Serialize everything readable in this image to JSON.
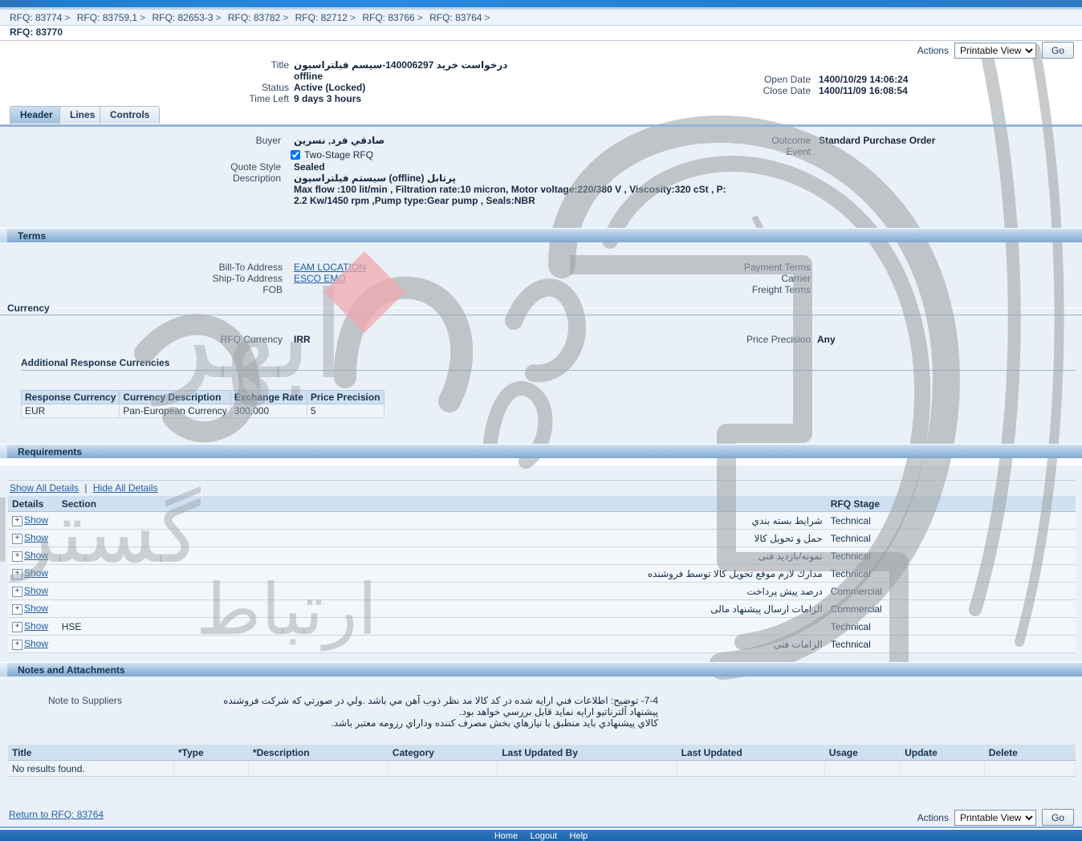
{
  "breadcrumb": {
    "items": [
      "RFQ: 83774",
      "RFQ: 83759,1",
      "RFQ: 82653-3",
      "RFQ: 83782",
      "RFQ: 82712",
      "RFQ: 83766",
      "RFQ: 83764"
    ],
    "separator": ">",
    "current": "RFQ: 83770"
  },
  "toolbar": {
    "actions_label": "Actions",
    "select_value": "Printable View",
    "go_label": "Go"
  },
  "header": {
    "title_label": "Title",
    "title_value_line1": "درخواست خريد 140006297-سيسم فيلتراسيون",
    "title_value_line2": "offline",
    "status_label": "Status",
    "status_value": "Active (Locked)",
    "time_left_label": "Time Left",
    "time_left_value": "9 days 3 hours",
    "open_date_label": "Open Date",
    "open_date_value": "1400/10/29 14:06:24",
    "close_date_label": "Close Date",
    "close_date_value": "1400/11/09 16:08:54"
  },
  "tabs": [
    {
      "label": "Header",
      "active": true
    },
    {
      "label": "Lines",
      "active": false
    },
    {
      "label": "Controls",
      "active": false
    }
  ],
  "main": {
    "buyer_label": "Buyer",
    "buyer_value": "صادقي فرد, نسرين",
    "two_stage_label": "Two-Stage RFQ",
    "two_stage_checked": true,
    "quote_style_label": "Quote Style",
    "quote_style_value": "Sealed",
    "description_label": "Description",
    "description_line1": "پرتابل (offline) سيستم فيلتراسيون",
    "description_line2": "Max flow :100 lit/min ,  Filtration rate:10 micron, Motor voltage:220/380 V , Viscosity:320 cSt , P:",
    "description_line3": "2.2 Kw/1450 rpm ,Pump type:Gear pump , Seals:NBR",
    "outcome_label": "Outcome",
    "outcome_value": "Standard Purchase Order",
    "event_label": "Event",
    "event_value": ""
  },
  "terms": {
    "section_title": "Terms",
    "bill_to_label": "Bill-To Address",
    "bill_to_value": "EAM LOCATION",
    "ship_to_label": "Ship-To Address",
    "ship_to_value": "ESCO EMO",
    "fob_label": "FOB",
    "fob_value": "",
    "payment_terms_label": "Payment Terms",
    "payment_terms_value": "",
    "carrier_label": "Carrier",
    "carrier_value": "",
    "freight_terms_label": "Freight Terms",
    "freight_terms_value": ""
  },
  "currency": {
    "section_title": "Currency",
    "rfq_currency_label": "RFQ Currency",
    "rfq_currency_value": "IRR",
    "price_precision_label": "Price Precision",
    "price_precision_value": "Any",
    "additional_title": "Additional Response Currencies",
    "table": {
      "columns": [
        "Response Currency",
        "Currency Description",
        "Exchange Rate",
        "Price Precision"
      ],
      "rows": [
        [
          "EUR",
          "Pan-European Currency",
          "300,000",
          "5"
        ]
      ]
    }
  },
  "requirements": {
    "section_title": "Requirements",
    "show_all_label": "Show All Details",
    "hide_all_label": "Hide All Details",
    "columns": [
      "Details",
      "Section",
      "RFQ Stage"
    ],
    "show_label": "Show",
    "expand_glyph": "+",
    "rows": [
      {
        "section": "شرايط بسته بندي",
        "stage": "Technical"
      },
      {
        "section": "حمل و تحویل کالا",
        "stage": "Technical"
      },
      {
        "section": "نمونه/بازدید فنی",
        "stage": "Technical"
      },
      {
        "section": "مدارك لازم موفع تحویل کالا توسط فروشنده",
        "stage": "Technical"
      },
      {
        "section": "درصد پیش پرداخت",
        "stage": "Commercial"
      },
      {
        "section": "الزامات ارسال پیشنهاد مالی",
        "stage": "Commercial"
      },
      {
        "section": "HSE",
        "stage": "Technical"
      },
      {
        "section": "الزامات فنی",
        "stage": "Technical"
      }
    ]
  },
  "notes": {
    "section_title": "Notes and Attachments",
    "note_label": "Note to Suppliers",
    "note_line1": "7-4- توضیح: اطلاعات فني ارایه شده در کد کالا  مد نظر ذوب آهن  مي باشد .ولي در صورتي که شرکت فروشنده",
    "note_line2": "پیشنهاد آلترناتیو ارایه نماید قابل بررسي خواهد بود.",
    "note_line3": "کالاي پیشنهادي باید منطبق با نیازهاي بخش مصرف کننده وداراي رزومه معتبر باشد."
  },
  "attachments": {
    "columns": [
      "Title",
      "*Type",
      "*Description",
      "Category",
      "Last Updated By",
      "Last Updated",
      "Usage",
      "Update",
      "Delete"
    ],
    "empty_message": "No results found."
  },
  "footer": {
    "return_link": "Return to RFQ: 83764",
    "actions_label": "Actions",
    "select_value": "Printable View",
    "go_label": "Go",
    "links": [
      "Home",
      "Logout",
      "Help"
    ]
  },
  "watermark": {
    "text_line": "ارتباط گستران ابهر"
  },
  "colors": {
    "accent_blue": "#2b8ade",
    "section_bar": "#a8c6e2",
    "panel_bg": "#eaf0f7",
    "link": "#1c5fa8"
  }
}
